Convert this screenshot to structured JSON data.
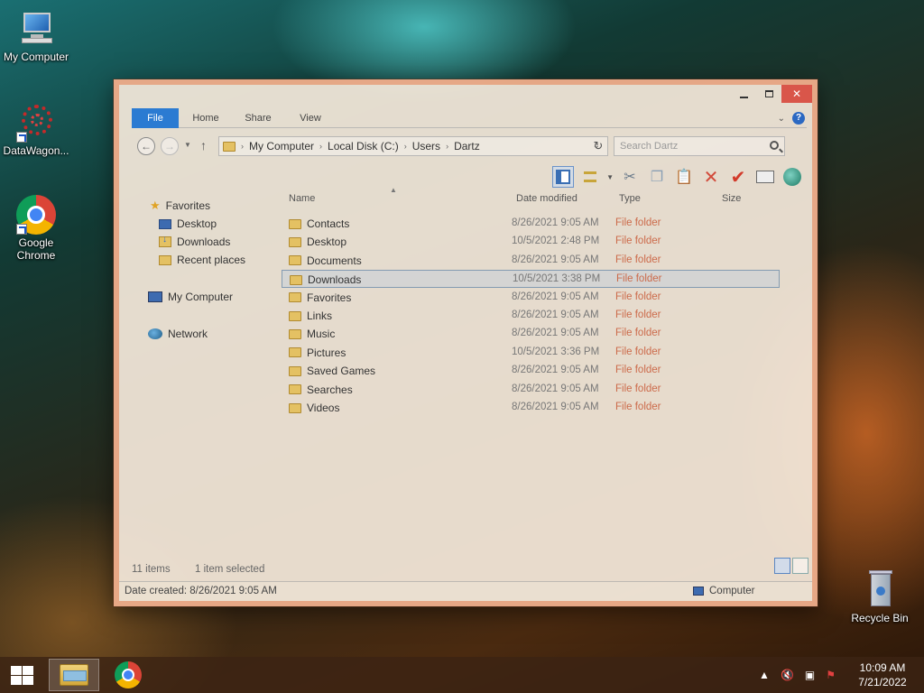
{
  "desktop": {
    "icons": [
      {
        "label": "My Computer"
      },
      {
        "label": "DataWagon..."
      },
      {
        "label": "Google Chrome"
      },
      {
        "label": "Recycle Bin"
      }
    ]
  },
  "window": {
    "ribbon_tabs": [
      "File",
      "Home",
      "Share",
      "View"
    ],
    "breadcrumb": [
      "My Computer",
      "Local Disk (C:)",
      "Users",
      "Dartz"
    ],
    "search_placeholder": "Search Dartz",
    "nav": {
      "favorites": "Favorites",
      "desktop": "Desktop",
      "downloads": "Downloads",
      "recent": "Recent places",
      "computer": "My Computer",
      "network": "Network"
    },
    "columns": {
      "name": "Name",
      "date": "Date modified",
      "type": "Type",
      "size": "Size"
    },
    "rows": [
      {
        "name": "Contacts",
        "date": "8/26/2021 9:05 AM",
        "type": "File folder"
      },
      {
        "name": "Desktop",
        "date": "10/5/2021 2:48 PM",
        "type": "File folder"
      },
      {
        "name": "Documents",
        "date": "8/26/2021 9:05 AM",
        "type": "File folder"
      },
      {
        "name": "Downloads",
        "date": "10/5/2021 3:38 PM",
        "type": "File folder",
        "selected": true
      },
      {
        "name": "Favorites",
        "date": "8/26/2021 9:05 AM",
        "type": "File folder"
      },
      {
        "name": "Links",
        "date": "8/26/2021 9:05 AM",
        "type": "File folder"
      },
      {
        "name": "Music",
        "date": "8/26/2021 9:05 AM",
        "type": "File folder"
      },
      {
        "name": "Pictures",
        "date": "10/5/2021 3:36 PM",
        "type": "File folder"
      },
      {
        "name": "Saved Games",
        "date": "8/26/2021 9:05 AM",
        "type": "File folder"
      },
      {
        "name": "Searches",
        "date": "8/26/2021 9:05 AM",
        "type": "File folder"
      },
      {
        "name": "Videos",
        "date": "8/26/2021 9:05 AM",
        "type": "File folder"
      }
    ],
    "status": {
      "items": "11 items",
      "selected": "1 item selected",
      "date_created": "Date created: 8/26/2021 9:05 AM",
      "location": "Computer"
    }
  },
  "taskbar": {
    "time": "10:09 AM",
    "date": "7/21/2022"
  },
  "colors": {
    "file_tab": "#2b7bd2",
    "close_button": "#d9564a",
    "type_text": "#cc6a4a"
  }
}
